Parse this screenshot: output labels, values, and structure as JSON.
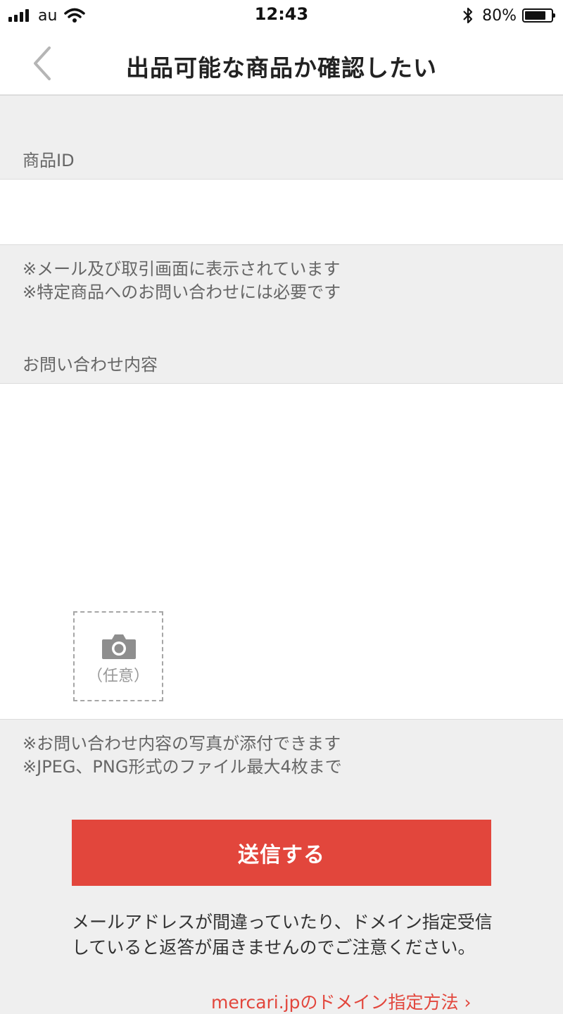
{
  "status_bar": {
    "carrier": "au",
    "time": "12:43",
    "battery": "80%",
    "battery_level": 0.8
  },
  "header": {
    "back_icon": "chevron-left-icon",
    "title": "出品可能な商品か確認したい"
  },
  "product_id": {
    "label": "商品ID",
    "value": "",
    "notes": [
      "※メール及び取引画面に表示されています",
      "※特定商品へのお問い合わせには必要です"
    ]
  },
  "inquiry": {
    "label": "お問い合わせ内容",
    "value": "",
    "photo_icon": "camera-icon",
    "photo_optional": "（任意）",
    "notes": [
      "※お問い合わせ内容の写真が添付できます",
      "※JPEG、PNG形式のファイル最大4枚まで"
    ]
  },
  "submit_label": "送信する",
  "warning_text": "メールアドレスが間違っていたり、ドメイン指定受信していると返答が届きませんのでご注意ください。",
  "domain_link": "mercari.jpのドメイン指定方法 ›",
  "colors": {
    "accent": "#e2463c",
    "background": "#efefef"
  }
}
